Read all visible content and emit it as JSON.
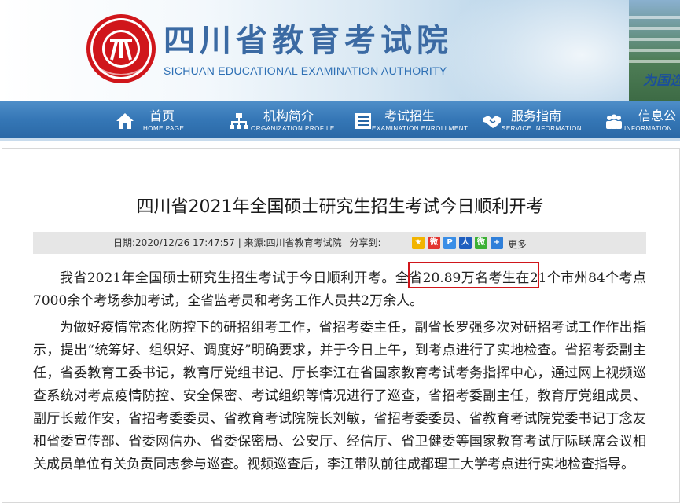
{
  "header": {
    "logo_title": "四川省教育考试院",
    "logo_subtitle": "SICHUAN EDUCATIONAL EXAMINATION AUTHORITY",
    "slogan": "为国选",
    "brand_red": "#d0161b",
    "brand_blue": "#3b6aa3"
  },
  "nav": {
    "items": [
      {
        "label": "首页",
        "sub": "HOME PAGE",
        "icon": "home-icon"
      },
      {
        "label": "机构简介",
        "sub": "ORGANIZATION PROFILE",
        "icon": "org-chart-icon"
      },
      {
        "label": "考试招生",
        "sub": "EXAMINATION ENROLLMENT",
        "icon": "document-list-icon"
      },
      {
        "label": "服务指南",
        "sub": "SERVICE INFORMATION",
        "icon": "handshake-icon"
      },
      {
        "label": "信息公",
        "sub": "INFORMATION",
        "icon": "people-icon"
      }
    ]
  },
  "article": {
    "title": "四川省2021年全国硕士研究生招生考试今日顺利开考",
    "meta": "日期:2020/12/26 17:47:57 | 来源:四川省教育考试院",
    "share_label": "分享到:",
    "share_more": "更多",
    "share_icons": [
      "qzone-icon",
      "weibo-icon",
      "pengyou-icon",
      "renren-icon",
      "wechat-icon",
      "plus-icon"
    ],
    "p1_before": "我省2021年全国硕士研究生招生考试于今日顺利开考。",
    "p1_highlight": "全省20.89万名考生",
    "p1_after": "在21个市州84个考点7000余个考场参加考试，全省监考员和考务工作人员共2万余人。",
    "p2": "为做好疫情常态化防控下的研招组考工作，省招考委主任，副省长罗强多次对研招考试工作作出指示，提出“统筹好、组织好、调度好”明确要求，并于今日上午，到考点进行了实地检查。省招考委副主任，省委教育工委书记，教育厅党组书记、厅长李江在省国家教育考试考务指挥中心，通过网上视频巡查系统对考点疫情防控、安全保密、考试组织等情况进行了巡查，省招考委副主任，教育厅党组成员、副厅长戴作安，省招考委委员、省教育考试院院长刘敏，省招考委委员、省教育考试院党委书记丁念友和省委宣传部、省委网信办、省委保密局、公安厅、经信厅、省卫健委等国家教育考试厅际联席会议相关成员单位有关负责同志参与巡查。视频巡查后，李江带队前往成都理工大学考点进行实地检查指导。"
  }
}
